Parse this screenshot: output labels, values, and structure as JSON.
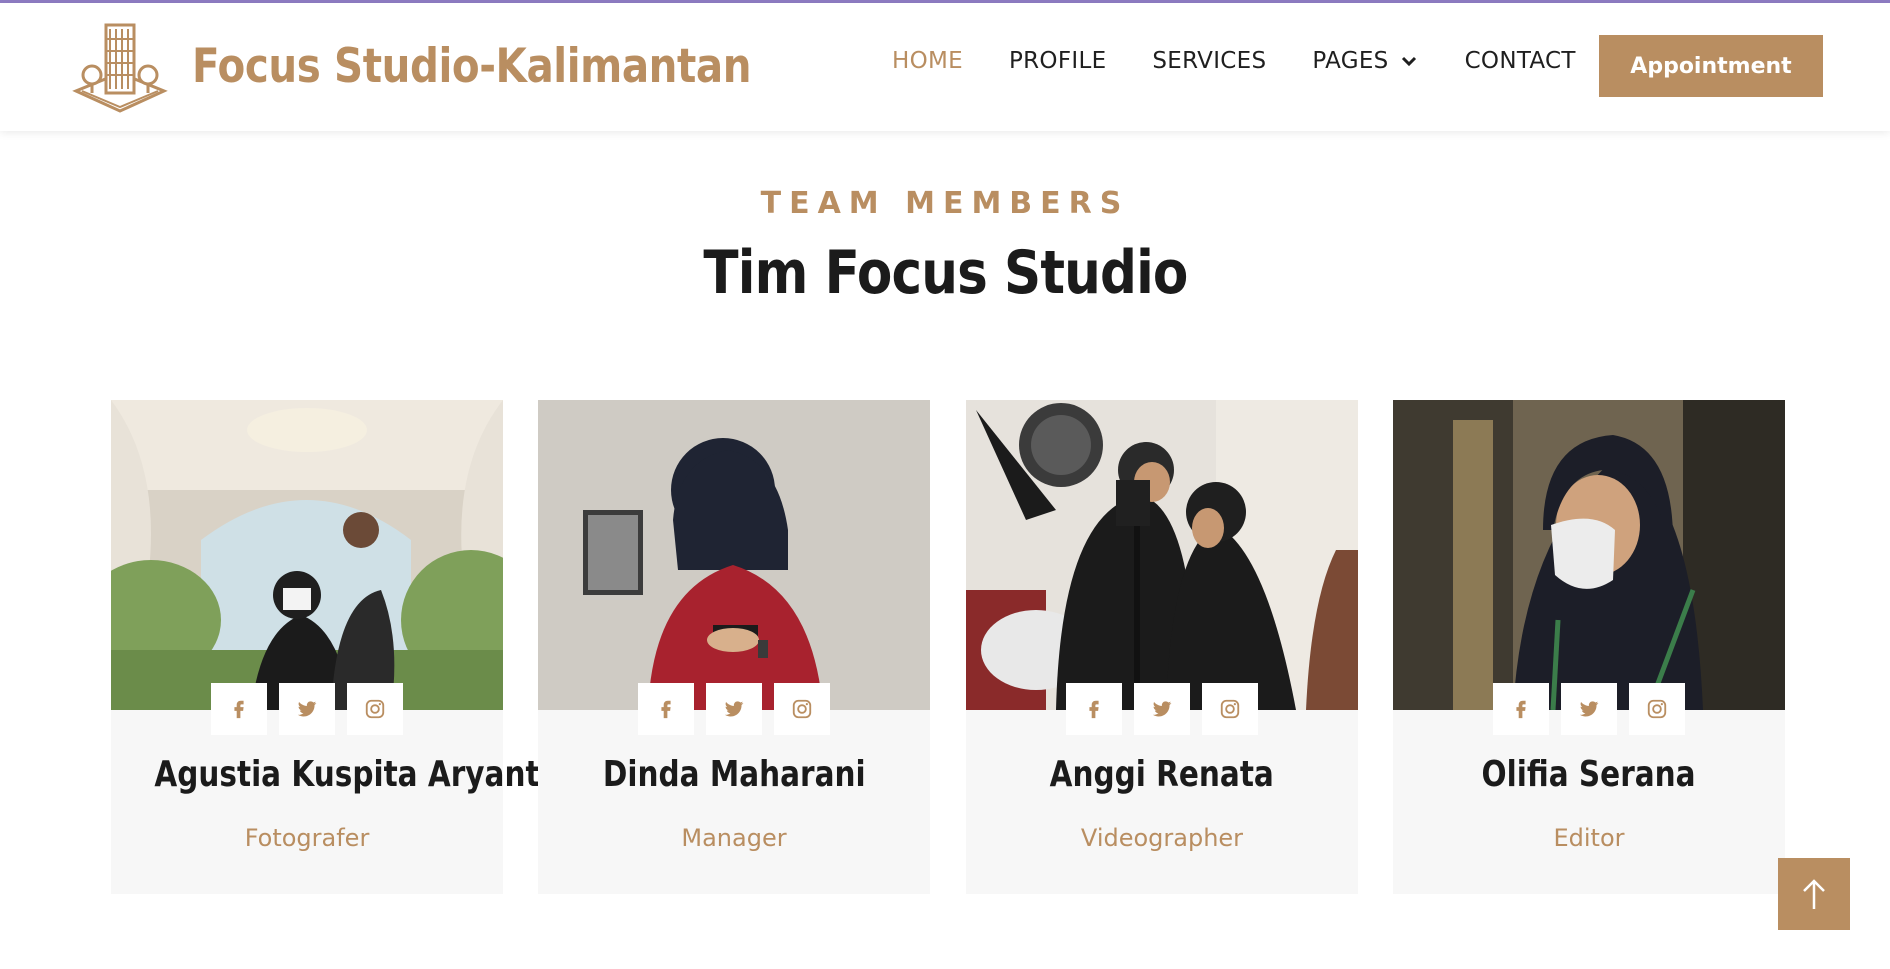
{
  "brand": {
    "name": "Focus Studio-Kalimantan",
    "logo_icon": "building-logo-icon",
    "color": "#b98e61"
  },
  "nav": {
    "items": [
      {
        "label": "HOME",
        "active": true
      },
      {
        "label": "PROFILE",
        "active": false
      },
      {
        "label": "SERVICES",
        "active": false
      },
      {
        "label": "PAGES",
        "active": false,
        "has_dropdown": true
      },
      {
        "label": "CONTACT",
        "active": false
      }
    ],
    "cta_label": "Appointment"
  },
  "section": {
    "subtitle": "TEAM MEMBERS",
    "title": "Tim Focus Studio"
  },
  "team": [
    {
      "name": "Agustia Kuspita Aryanti",
      "role": "Fotografer"
    },
    {
      "name": "Dinda Maharani",
      "role": "Manager"
    },
    {
      "name": "Anggi Renata",
      "role": "Videographer"
    },
    {
      "name": "Olifia Serana",
      "role": "Editor"
    }
  ],
  "social_icons": [
    "facebook-icon",
    "twitter-icon",
    "instagram-icon"
  ],
  "colors": {
    "accent": "#b98e61",
    "text_dark": "#1b1b1b",
    "card_bg": "#f7f7f7",
    "top_line": "#8e7cc3"
  },
  "scroll_top_icon": "arrow-up-icon"
}
